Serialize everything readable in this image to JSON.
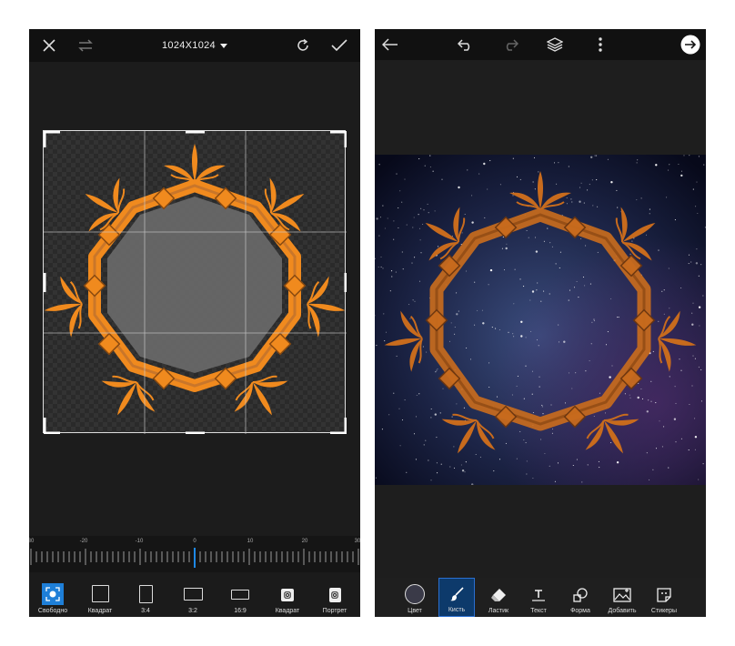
{
  "left_screen": {
    "title": "1024X1024",
    "icons": {
      "close": "close-icon",
      "flip": "flip-icon",
      "reset": "reset-icon",
      "apply": "check-icon"
    },
    "ruler": {
      "labels": [
        "30",
        "-20",
        "-10",
        "0",
        "10",
        "20",
        "30"
      ]
    },
    "aspect_options": [
      {
        "label": "Свободно",
        "icon": "free-crop-icon",
        "active": true
      },
      {
        "label": "Квадрат",
        "icon": "square-icon",
        "active": false
      },
      {
        "label": "3:4",
        "icon": "ratio-3-4-icon",
        "active": false
      },
      {
        "label": "3:2",
        "icon": "ratio-3-2-icon",
        "active": false
      },
      {
        "label": "16:9",
        "icon": "ratio-16-9-icon",
        "active": false
      },
      {
        "label": "Квадрат",
        "icon": "instagram-square-icon",
        "active": false
      },
      {
        "label": "Портрет",
        "icon": "instagram-portrait-icon",
        "active": false
      }
    ]
  },
  "right_screen": {
    "icons": {
      "back": "back-arrow-icon",
      "undo": "undo-icon",
      "redo": "redo-icon",
      "layers": "layers-icon",
      "more": "more-icon",
      "next": "next-arrow-icon"
    },
    "tools": [
      {
        "label": "Цвет",
        "icon": "color-circle-icon",
        "active": false
      },
      {
        "label": "Кисть",
        "icon": "brush-icon",
        "active": true
      },
      {
        "label": "Ластик",
        "icon": "eraser-icon",
        "active": false
      },
      {
        "label": "Текст",
        "icon": "text-icon",
        "active": false
      },
      {
        "label": "Форма",
        "icon": "shape-icon",
        "active": false
      },
      {
        "label": "Добавить",
        "icon": "add-image-icon",
        "active": false
      },
      {
        "label": "Стикеры",
        "icon": "sticker-icon",
        "active": false
      }
    ]
  },
  "colors": {
    "accent": "#1e88e5",
    "frame_orange": "#f08a1e",
    "background": "#1e1e1e"
  }
}
